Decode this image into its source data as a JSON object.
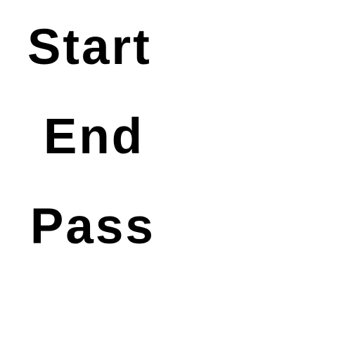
{
  "items": [
    {
      "label": "Start"
    },
    {
      "label": "End"
    },
    {
      "label": "Pass"
    }
  ],
  "colors": {
    "text": "#000000",
    "background": "#ffffff"
  }
}
